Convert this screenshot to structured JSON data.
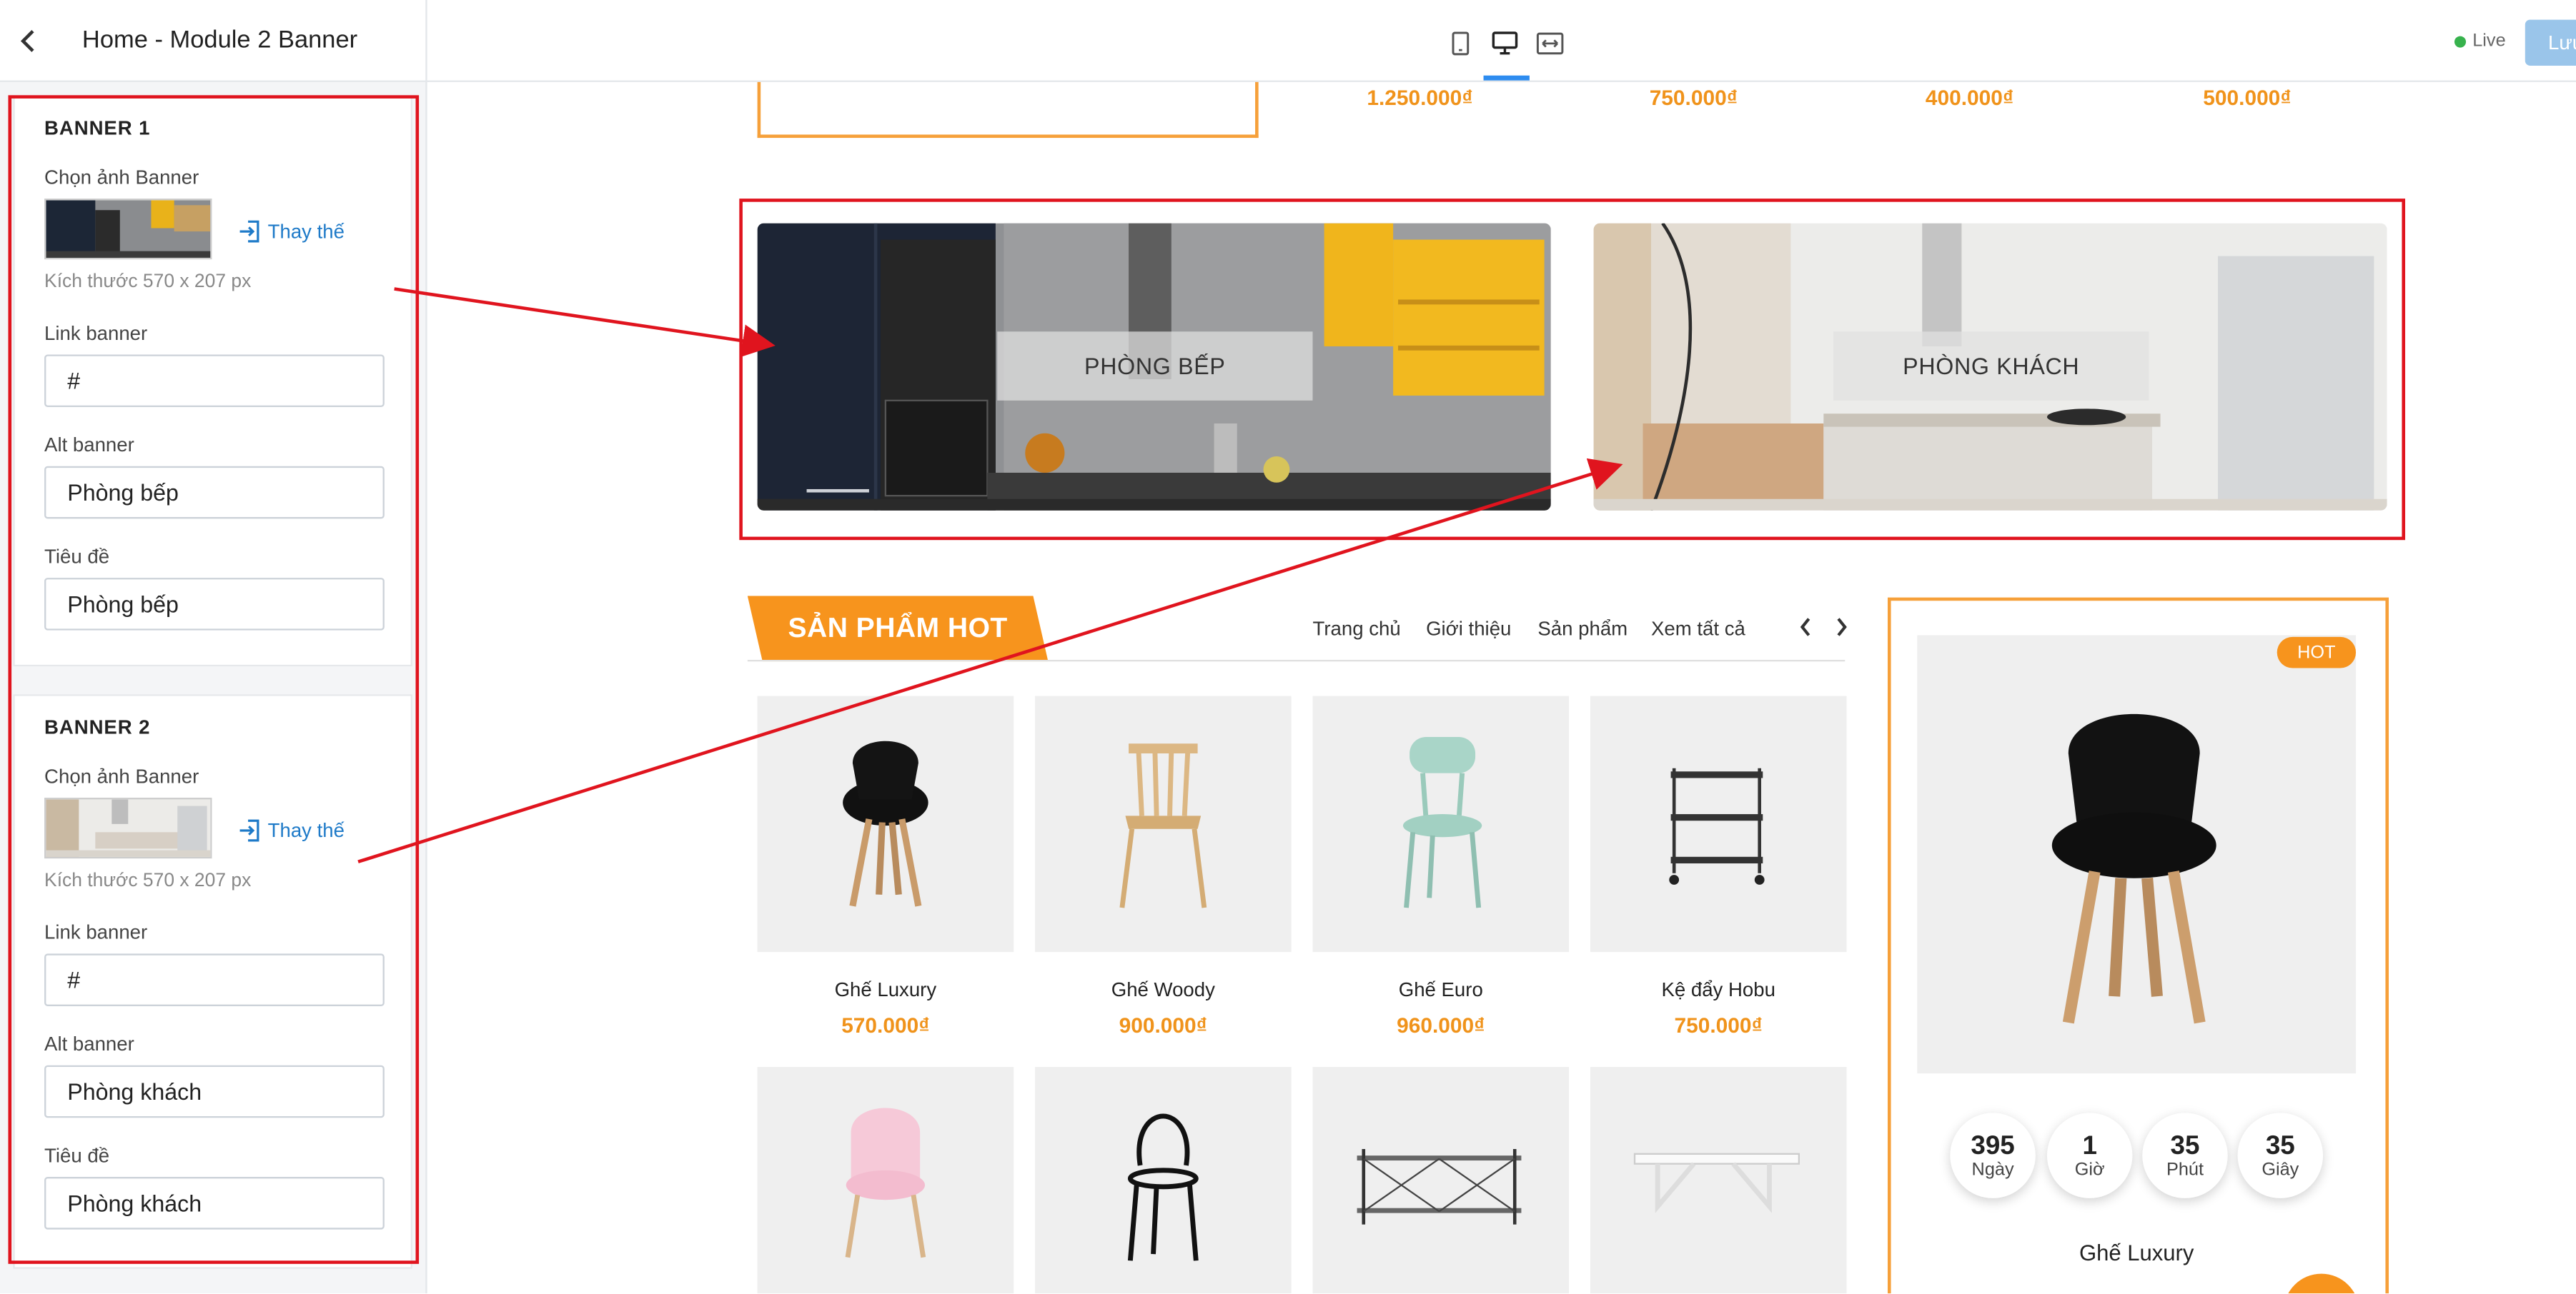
{
  "header": {
    "title": "Home - Module 2 Banner",
    "live_label": "Live",
    "save_label": "Lưu"
  },
  "sidebar": {
    "banners": [
      {
        "heading": "BANNER 1",
        "image_label": "Chọn ảnh Banner",
        "replace_label": "Thay thế",
        "size_hint": "Kích thước 570 x 207 px",
        "link_label": "Link banner",
        "link_value": "#",
        "alt_label": "Alt banner",
        "alt_value": "Phòng bếp",
        "title_label": "Tiêu đề",
        "title_value": "Phòng bếp"
      },
      {
        "heading": "BANNER 2",
        "image_label": "Chọn ảnh Banner",
        "replace_label": "Thay thế",
        "size_hint": "Kích thước 570 x 207 px",
        "link_label": "Link banner",
        "link_value": "#",
        "alt_label": "Alt banner",
        "alt_value": "Phòng khách",
        "title_label": "Tiêu đề",
        "title_value": "Phòng khách"
      }
    ]
  },
  "preview": {
    "top_prices": [
      "1.250.000₫",
      "750.000₫",
      "400.000₫",
      "500.000₫"
    ],
    "banners": [
      {
        "title": "PHÒNG BẾP"
      },
      {
        "title": "PHÒNG KHÁCH"
      }
    ],
    "hot_section": {
      "title": "SẢN PHẨM HOT",
      "nav": [
        "Trang chủ",
        "Giới thiệu",
        "Sản phẩm",
        "Xem tất cả"
      ],
      "products": [
        {
          "name": "Ghế Luxury",
          "price": "570.000₫"
        },
        {
          "name": "Ghế Woody",
          "price": "900.000₫"
        },
        {
          "name": "Ghế Euro",
          "price": "960.000₫"
        },
        {
          "name": "Kệ đẩy Hobu",
          "price": "750.000₫"
        }
      ]
    },
    "deal": {
      "badge": "HOT",
      "countdown": [
        {
          "value": "395",
          "unit": "Ngày"
        },
        {
          "value": "1",
          "unit": "Giờ"
        },
        {
          "value": "35",
          "unit": "Phút"
        },
        {
          "value": "35",
          "unit": "Giây"
        }
      ],
      "name": "Ghế Luxury"
    }
  },
  "colors": {
    "accent_orange": "#f7941d",
    "annotation_red": "#e0141e",
    "link_blue": "#1e7ac8"
  }
}
